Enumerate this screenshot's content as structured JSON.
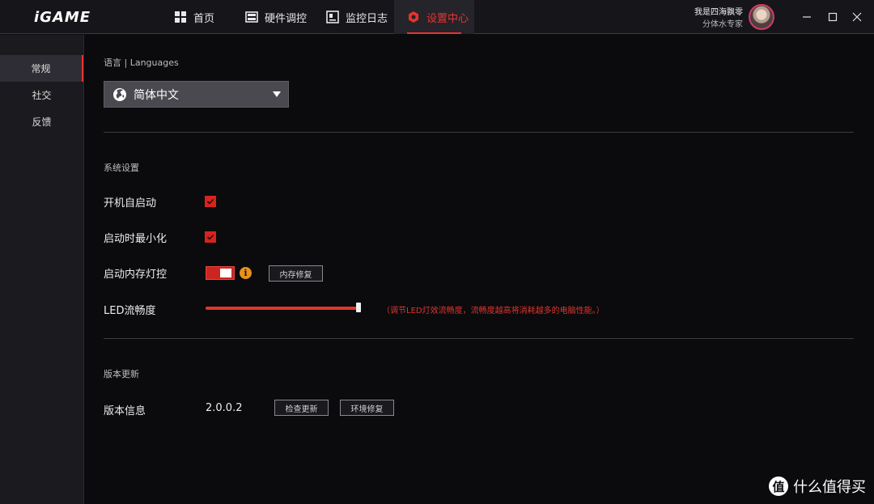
{
  "brand": {
    "logo_text": "iGAME"
  },
  "tabs": [
    {
      "label": "首页",
      "icon": "grid-icon"
    },
    {
      "label": "硬件调控",
      "icon": "hardware-icon"
    },
    {
      "label": "监控日志",
      "icon": "monitor-log-icon"
    },
    {
      "label": "设置中心",
      "icon": "settings-hexagon-icon",
      "active": true
    }
  ],
  "user": {
    "name": "我是四海飘零",
    "subtitle": "分体水专家"
  },
  "window_controls": [
    "minimize",
    "maximize",
    "close"
  ],
  "sidebar": {
    "items": [
      {
        "label": "常规",
        "active": true
      },
      {
        "label": "社交"
      },
      {
        "label": "反馈"
      }
    ]
  },
  "language": {
    "section_label": "语言 | Languages",
    "selected": "简体中文"
  },
  "system": {
    "section_label": "系统设置",
    "autostart_label": "开机自启动",
    "autostart_checked": true,
    "minimize_label": "启动时最小化",
    "minimize_checked": true,
    "memory_led_label": "启动内存灯控",
    "memory_led_on": true,
    "memory_fix_button": "内存修复",
    "led_smooth_label": "LED流畅度",
    "led_smooth_level": 1.0,
    "led_smooth_hint": "（调节LED灯效流畅度，流畅度越高将消耗越多的电脑性能。）"
  },
  "update": {
    "section_label": "版本更新",
    "version_label": "版本信息",
    "version_value": "2.0.0.2",
    "check_button": "检查更新",
    "repair_button": "环境修复"
  },
  "watermark": {
    "icon_text": "值",
    "text": "什么值得买"
  },
  "colors": {
    "accent": "#e8332d",
    "background": "#0b0a0d",
    "sidebar": "#1b1a1e",
    "titlebar": "#161519"
  }
}
